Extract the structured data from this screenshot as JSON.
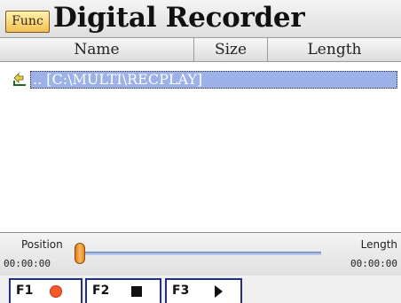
{
  "titlebar": {
    "func_label": "Func",
    "title": "Digital Recorder"
  },
  "columns": {
    "name": "Name",
    "size": "Size",
    "length": "Length"
  },
  "file_list": {
    "rows": [
      {
        "icon": "up-folder-icon",
        "label": ".. [C:\\MULTI\\RECPLAY]",
        "selected": true
      }
    ]
  },
  "position": {
    "label": "Position",
    "time": "00:00:00",
    "value": 0.0
  },
  "length": {
    "label": "Length",
    "time": "00:00:00"
  },
  "fkeys": {
    "f1": {
      "label": "F1",
      "icon": "record-icon"
    },
    "f2": {
      "label": "F2",
      "icon": "stop-icon"
    },
    "f3": {
      "label": "F3",
      "icon": "play-icon"
    }
  },
  "colors": {
    "selection": "#9bb1e8",
    "func_button": "#f2bf53",
    "record": "#f25a2a",
    "fkey_border": "#23307a",
    "slider_thumb": "#e08a22"
  }
}
